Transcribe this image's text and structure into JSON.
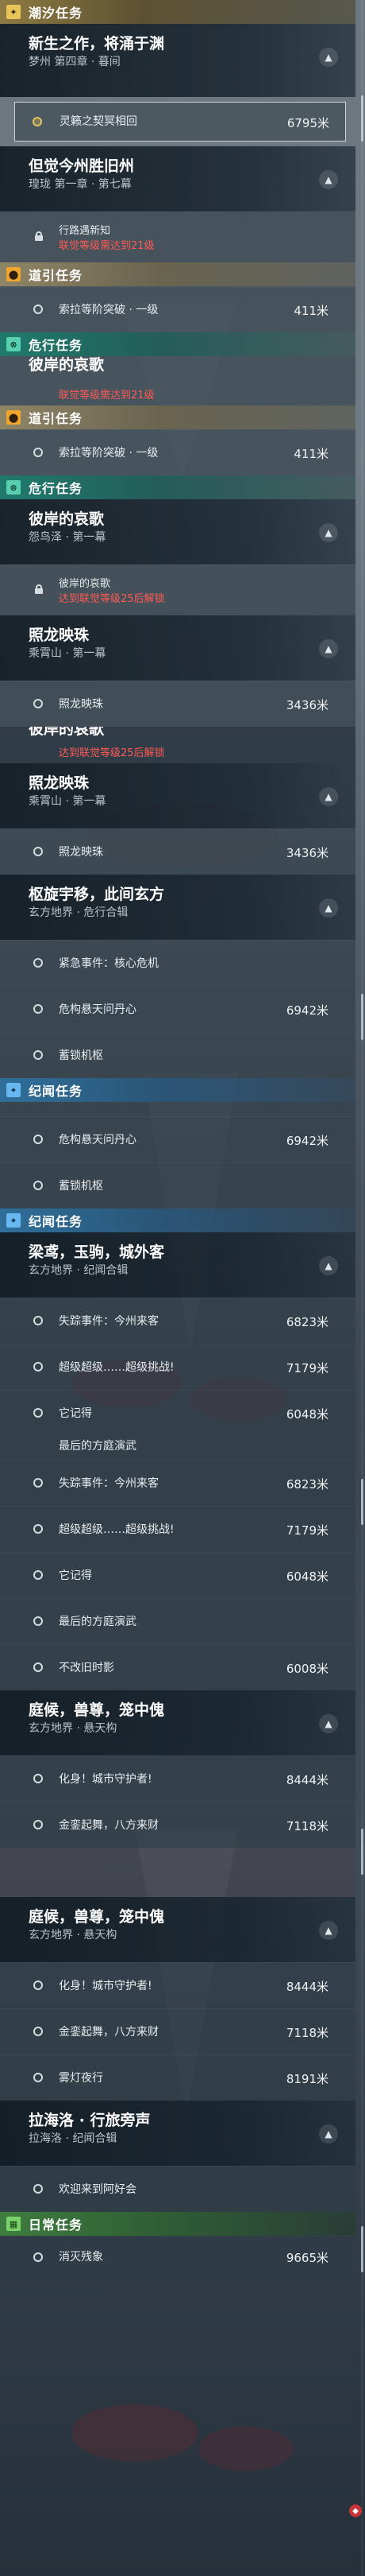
{
  "categories": {
    "chaoxi": "潮汐任务",
    "daoyin": "道引任务",
    "weiyun": "危行任务",
    "jiwen": "纪闻任务",
    "richang": "日常任务"
  },
  "icons": {
    "chaoxi": "plus-diamond-icon",
    "daoyin": "location-pin-icon",
    "weiyun": "shield-crossed-icon",
    "jiwen": "plus-diamond-icon",
    "richang": "calendar-icon"
  },
  "quests": {
    "xinsheng": {
      "title": "新生之作，将涌于渊",
      "subtitle": "梦州 第四章 · 暮间",
      "objectives": [
        {
          "text": "灵籁之契冥相回",
          "dist": "6795米"
        }
      ]
    },
    "danjue": {
      "title": "但觉今州胜旧州",
      "subtitle": "瑝珑 第一章 · 第七幕",
      "locked": {
        "line1": "行路遇新知",
        "line2": "联觉等级需达到21级"
      }
    },
    "daoyin_task": {
      "objectives": [
        {
          "text": "索拉等阶突破 · 一级",
          "dist": "411米"
        }
      ]
    },
    "bian": {
      "title": "彼岸的哀歌",
      "subtitle": "怨鸟泽 · 第一幕",
      "locked": {
        "line1": "彼岸的哀歌",
        "line2": "达到联觉等级25后解锁"
      }
    },
    "zhaolong": {
      "title": "照龙映珠",
      "subtitle": "乘霄山 · 第一幕",
      "objectives": [
        {
          "text": "照龙映珠",
          "dist": "3436米"
        }
      ]
    },
    "shuxuan": {
      "title": "枢旋宇移，此间玄方",
      "subtitle": "玄方地界 · 危行合辑",
      "objectives": [
        {
          "text": "紧急事件：核心危机",
          "dist": ""
        },
        {
          "text": "危构悬天问丹心",
          "dist": "6942米"
        },
        {
          "text": "蓄锁机枢",
          "dist": ""
        }
      ]
    },
    "liangyuan": {
      "title": "梁鸢，玉驹，城外客",
      "subtitle": "玄方地界 · 纪闻合辑",
      "objectives": [
        {
          "text": "失踪事件：今州来客",
          "dist": "6823米"
        },
        {
          "text": "超级超级……超级挑战!",
          "dist": "7179米"
        },
        {
          "text": "它记得",
          "dist": "6048米"
        },
        {
          "text": "最后的方庭演武",
          "dist": ""
        },
        {
          "text": "不改旧时影",
          "dist": "6008米"
        }
      ]
    },
    "tinghou": {
      "title": "庭候，兽尊，笼中傀",
      "subtitle": "玄方地界 · 悬天构",
      "objectives": [
        {
          "text": "化身！城市守护者!",
          "dist": "8444米"
        },
        {
          "text": "金銮起舞，八方来财",
          "dist": "7118米"
        },
        {
          "text": "雾灯夜行",
          "dist": "8191米"
        }
      ]
    },
    "lahai": {
      "title": "拉海洛 · 行旅旁声",
      "subtitle": "拉海洛 · 纪闻合辑",
      "objectives": [
        {
          "text": "欢迎来到阿好会",
          "dist": ""
        }
      ]
    },
    "richang_task": {
      "objectives": [
        {
          "text": "消灭残象",
          "dist": "9665米"
        }
      ]
    }
  },
  "colors": {
    "accent_gold": "#e8c35a",
    "warning_red": "#ff5a54",
    "daoyin": "#f0a62d",
    "weiyun": "#58d0b0",
    "jiwen": "#67b8f0",
    "richang": "#7ad36a"
  }
}
